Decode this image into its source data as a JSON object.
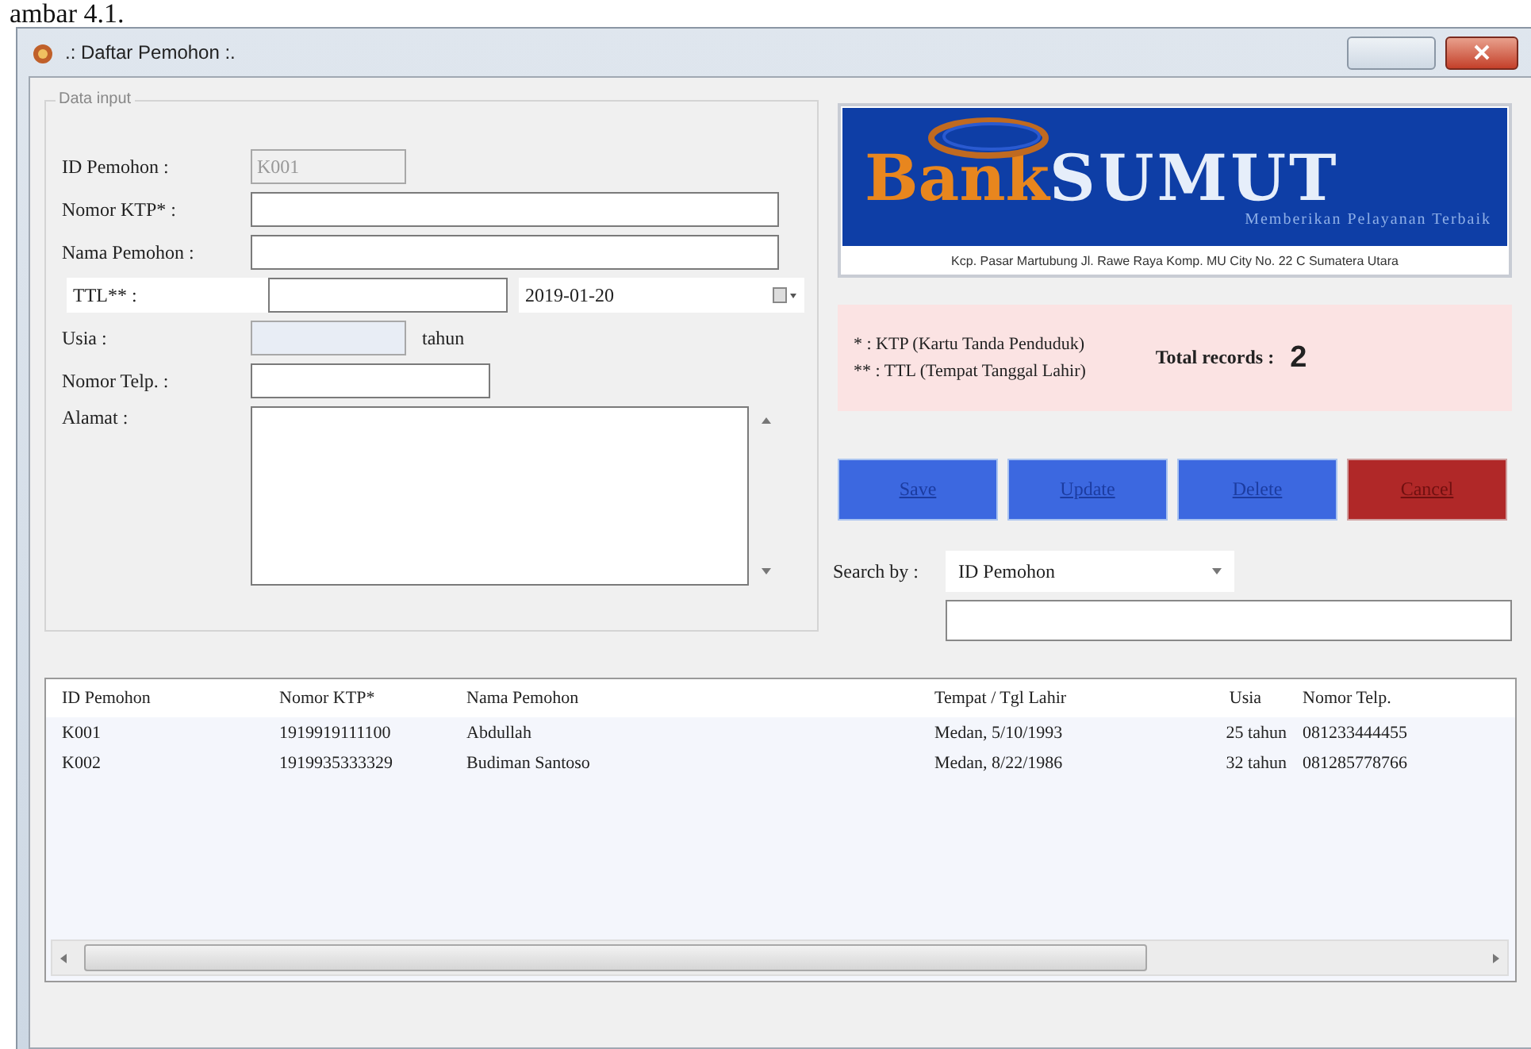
{
  "caption": "ambar 4.1.",
  "window": {
    "title": ".: Daftar Pemohon :."
  },
  "group": {
    "title": "Data input"
  },
  "fields": [
    {
      "kind": "text",
      "label": "ID Pemohon :",
      "value": "K001",
      "disabled": true
    },
    {
      "kind": "text",
      "label": "Nomor KTP* :",
      "disabled": false
    },
    {
      "kind": "text",
      "label": "Nama Pemohon :",
      "disabled": false
    },
    {
      "kind": "date",
      "label": "TTL** :",
      "date": "2019-01-20",
      "disabled": false
    },
    {
      "kind": "suffix",
      "label": "Usia :",
      "suffix": "tahun",
      "disabled": true
    },
    {
      "kind": "text",
      "label": "Nomor Telp. :",
      "disabled": false
    },
    {
      "kind": "memo",
      "label": "Alamat :"
    }
  ],
  "logo": {
    "brand_left": "Bank",
    "brand_right": "SUMUT",
    "tagline": "Memberikan Pelayanan Terbaik",
    "address": "Kcp. Pasar Martubung Jl. Rawe Raya Komp. MU City No. 22 C Sumatera Utara"
  },
  "notes": [
    "* : KTP (Kartu Tanda Penduduk)",
    "** : TTL (Tempat Tanggal Lahir)"
  ],
  "total": {
    "label": "Total records :",
    "value": "2"
  },
  "buttons": [
    {
      "label": "Save",
      "kind": "primary"
    },
    {
      "label": "Update",
      "kind": "primary"
    },
    {
      "label": "Delete",
      "kind": "primary"
    },
    {
      "label": "Cancel",
      "kind": "danger"
    }
  ],
  "search": {
    "label": "Search by :",
    "option": "ID Pemohon"
  },
  "table": {
    "columns": [
      "ID Pemohon",
      "Nomor KTP*",
      "Nama Pemohon",
      "Tempat / Tgl Lahir",
      "Usia",
      "Nomor Telp."
    ],
    "rows": [
      [
        "K001",
        "1919919111100",
        "Abdullah",
        "Medan, 5/10/1993",
        "25 tahun",
        "081233444455"
      ],
      [
        "K002",
        "1919935333329",
        "Budiman Santoso",
        "Medan, 8/22/1986",
        "32 tahun",
        "081285778766"
      ]
    ]
  }
}
